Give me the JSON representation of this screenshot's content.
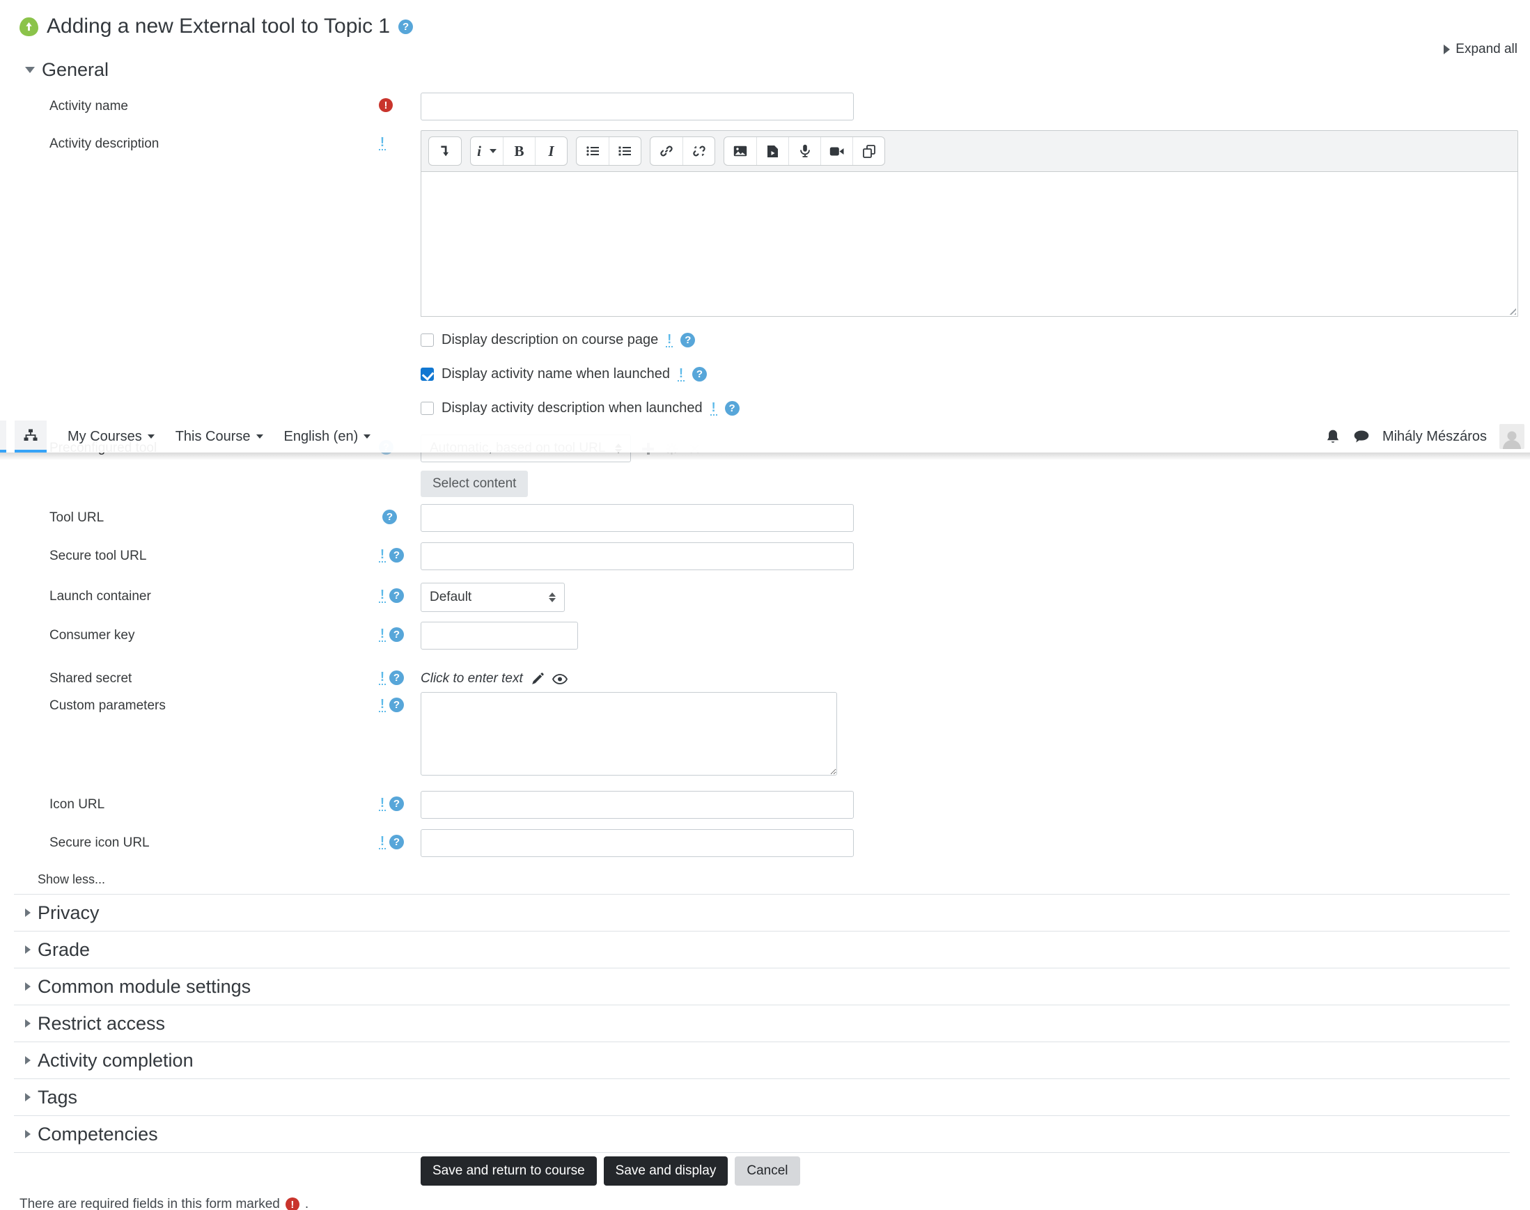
{
  "page": {
    "title": "Adding a new External tool to Topic 1",
    "expand_all": "Expand all",
    "required_note_prefix": "There are required fields in this form marked",
    "required_note_suffix": "."
  },
  "icons": {
    "help_glyph": "?",
    "required_glyph": "!",
    "advanced_glyph": "!"
  },
  "navbar": {
    "my_courses": "My Courses",
    "this_course": "This Course",
    "language": "English (en)",
    "user_name": "Mihály Mészáros"
  },
  "editor_toolbar": {
    "style_letter": "i",
    "bold": "B",
    "italic": "I"
  },
  "form": {
    "activity_name": {
      "label": "Activity name",
      "value": ""
    },
    "activity_description": {
      "label": "Activity description",
      "value": ""
    },
    "checkboxes": [
      {
        "label": "Display description on course page",
        "checked": false
      },
      {
        "label": "Display activity name when launched",
        "checked": true
      },
      {
        "label": "Display activity description when launched",
        "checked": false
      }
    ],
    "preconfigured_tool": {
      "label": "Preconfigured tool",
      "selected": "Automatic, based on tool URL"
    },
    "select_content_button": "Select content",
    "tool_url": {
      "label": "Tool URL",
      "value": ""
    },
    "secure_tool_url": {
      "label": "Secure tool URL",
      "value": ""
    },
    "launch_container": {
      "label": "Launch container",
      "selected": "Default"
    },
    "consumer_key": {
      "label": "Consumer key",
      "value": ""
    },
    "shared_secret": {
      "label": "Shared secret",
      "placeholder": "Click to enter text"
    },
    "custom_parameters": {
      "label": "Custom parameters",
      "value": ""
    },
    "icon_url": {
      "label": "Icon URL",
      "value": ""
    },
    "secure_icon_url": {
      "label": "Secure icon URL",
      "value": ""
    }
  },
  "sections": {
    "general": "General",
    "show_less": "Show less...",
    "collapsed": [
      {
        "label": "Privacy"
      },
      {
        "label": "Grade"
      },
      {
        "label": "Common module settings"
      },
      {
        "label": "Restrict access"
      },
      {
        "label": "Activity completion"
      },
      {
        "label": "Tags"
      },
      {
        "label": "Competencies"
      }
    ]
  },
  "buttons": {
    "save_return": "Save and return to course",
    "save_display": "Save and display",
    "cancel": "Cancel"
  },
  "colors": {
    "accent_blue": "#36a3f7",
    "help_icon": "#57a6d9",
    "required_red": "#c9342c",
    "checkbox_checked": "#1177d1",
    "button_dark": "#24272b",
    "lti_green": "#8bc34a"
  }
}
